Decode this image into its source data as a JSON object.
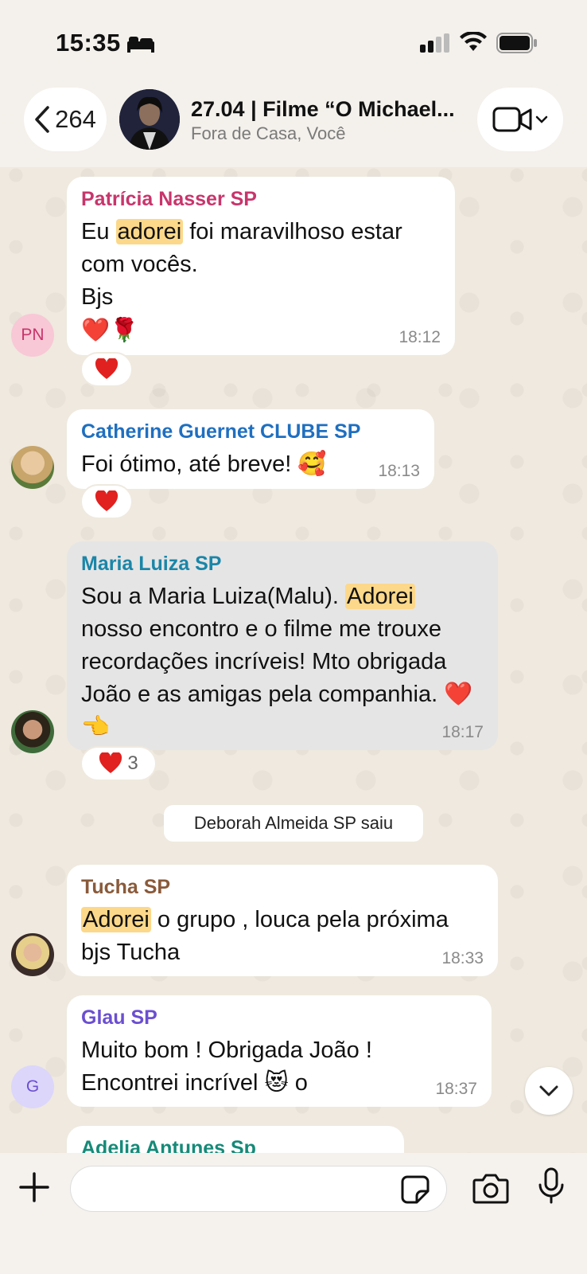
{
  "status_bar": {
    "time": "15:35"
  },
  "header": {
    "back_count": "264",
    "group_title": "27.04 | Filme “O Michael...",
    "group_subtitle": "Fora de Casa, Você"
  },
  "messages": [
    {
      "sender": "Patrícia Nasser SP",
      "sender_color": "#c8356b",
      "text_before": "Eu ",
      "highlight": "adorei",
      "text_after": "  foi maravilhoso estar com vocês.",
      "line2": "Bjs",
      "emojis": "❤️🌹",
      "time": "18:12",
      "avatar_initials": "PN",
      "reaction_count": ""
    },
    {
      "sender": "Catherine Guernet CLUBE SP",
      "sender_color": "#1f6fc0",
      "text": "Foi ótimo, até breve! 🥰",
      "time": "18:13"
    },
    {
      "sender": "Maria Luiza SP",
      "sender_color": "#1a86a8",
      "text_before": "Sou a Maria Luiza(Malu). ",
      "highlight": "Adorei",
      "text_after": " nosso encontro e o filme me trouxe recordações incríveis! Mto obrigada João e as amigas pela companhia. ❤️👈",
      "time": "18:17",
      "reaction_count": "3"
    },
    {
      "sender": "Tucha SP",
      "sender_color": "#8a5a3a",
      "highlight": "Adorei",
      "text_after": " o grupo , louca pela próxima bjs Tucha",
      "time": "18:33"
    },
    {
      "sender": "Glau SP",
      "sender_color": "#6b4fd1",
      "text": "Muito bom ! Obrigada João ! Encontrei incrível 😻 o",
      "time": "18:37",
      "avatar_initials": "G"
    },
    {
      "sender": "Adelia Antunes Sp",
      "sender_color": "#158a78"
    }
  ],
  "system_message": "Deborah Almeida SP saiu",
  "composer": {
    "placeholder": ""
  }
}
